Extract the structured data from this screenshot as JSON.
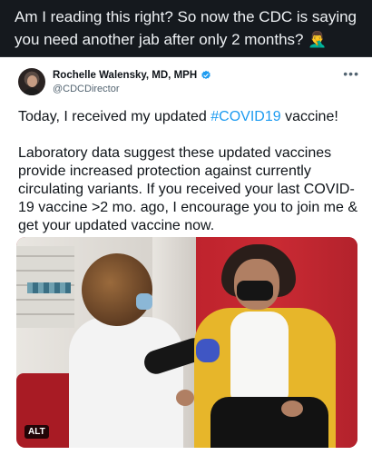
{
  "caption": "Am I reading this right? So now the CDC is saying you need another jab after only 2 months? 🤦‍♂️",
  "tweet": {
    "author_name": "Rochelle Walensky, MD, MPH",
    "author_handle": "@CDCDirector",
    "verified_icon": "verified-badge-icon",
    "more_icon": "more-options-icon",
    "line1_prefix": "Today, I received my updated ",
    "hashtag": "#COVID19",
    "line1_suffix": " vaccine!",
    "paragraph2": "Laboratory data suggest these updated vaccines provide increased protection against currently circulating variants. If you received your last COVID-19 vaccine >2 mo. ago, I encourage you to join me & get your updated vaccine now.",
    "alt_label": "ALT"
  },
  "colors": {
    "background": "#15191e",
    "card": "#ffffff",
    "link": "#1d9bf0",
    "verified": "#1d9bf0"
  }
}
